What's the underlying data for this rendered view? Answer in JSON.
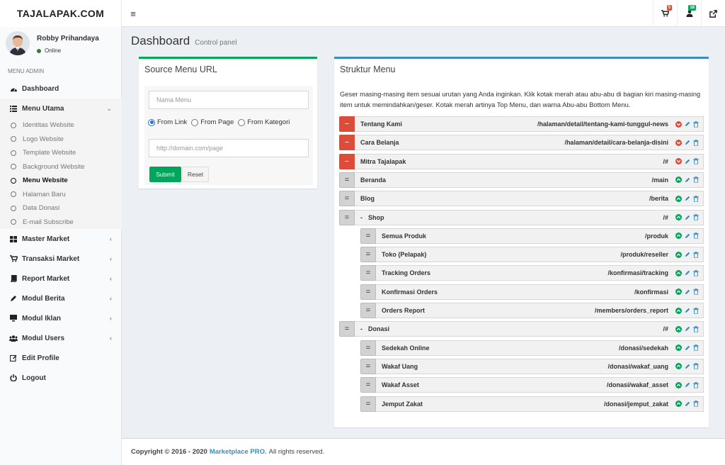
{
  "header": {
    "brand": "TAJALAPAK.COM",
    "cart_badge": "5",
    "users_badge": "18"
  },
  "colors": {
    "accent": "#3c8dbc",
    "success": "#00a65a",
    "danger": "#dd4b39"
  },
  "user": {
    "name": "Robby Prihandaya",
    "status": "Online"
  },
  "sidebar": {
    "header": "MENU ADMIN",
    "items": [
      {
        "label": "Dashboard",
        "icon": "dashboard-icon"
      },
      {
        "label": "Menu Utama",
        "icon": "list-icon"
      },
      {
        "label": "Master Market",
        "icon": "grid-icon"
      },
      {
        "label": "Transaksi Market",
        "icon": "cart-icon"
      },
      {
        "label": "Report Market",
        "icon": "book-icon"
      },
      {
        "label": "Modul Berita",
        "icon": "pencil-icon"
      },
      {
        "label": "Modul Iklan",
        "icon": "tv-icon"
      },
      {
        "label": "Modul Users",
        "icon": "users-icon"
      },
      {
        "label": "Edit Profile",
        "icon": "edit-icon"
      },
      {
        "label": "Logout",
        "icon": "power-icon"
      }
    ],
    "submenu": [
      "Identitas Website",
      "Logo Website",
      "Template Website",
      "Background Website",
      "Menu Website",
      "Halaman Baru",
      "Data Donasi",
      "E-mail Subscribe"
    ]
  },
  "page": {
    "title": "Dashboard",
    "subtitle": "Control panel"
  },
  "source_box": {
    "title": "Source Menu URL",
    "name_placeholder": "Nama Menu",
    "radio_options": [
      "From Link",
      "From Page",
      "From Kategori"
    ],
    "selected": "From Link",
    "url_placeholder": "http://domain.com/page",
    "submit": "Submit",
    "reset": "Reset"
  },
  "struktur": {
    "title": "Struktur Menu",
    "instructions": "Geser masing-masing item sesuai urutan yang Anda inginkan. Klik kotak merah atau abu-abu di bagian kiri masing-masing item untuk memindahkan/geser. Kotak merah artinya Top Menu, dan warna Abu-abu Bottom Menu.",
    "items": [
      {
        "title": "Tentang Kami",
        "link": "/halaman/detail/tentang-kami-tunggul-news",
        "type": "top",
        "level": 0
      },
      {
        "title": "Cara Belanja",
        "link": "/halaman/detail/cara-belanja-disini",
        "type": "top",
        "level": 0
      },
      {
        "title": "Mitra Tajalapak",
        "link": "/#",
        "type": "top",
        "level": 0
      },
      {
        "title": "Beranda",
        "link": "/main",
        "type": "bottom",
        "level": 0
      },
      {
        "title": "Blog",
        "link": "/berita",
        "type": "bottom",
        "level": 0
      },
      {
        "title": "Shop",
        "link": "/#",
        "type": "bottom",
        "level": 0,
        "collapsible": true
      },
      {
        "title": "Semua Produk",
        "link": "/produk",
        "type": "bottom",
        "level": 1
      },
      {
        "title": "Toko (Pelapak)",
        "link": "/produk/reseller",
        "type": "bottom",
        "level": 1
      },
      {
        "title": "Tracking Orders",
        "link": "/konfirmasi/tracking",
        "type": "bottom",
        "level": 1
      },
      {
        "title": "Konfirmasi Orders",
        "link": "/konfirmasi",
        "type": "bottom",
        "level": 1
      },
      {
        "title": "Orders Report",
        "link": "/members/orders_report",
        "type": "bottom",
        "level": 1
      },
      {
        "title": "Donasi",
        "link": "/#",
        "type": "bottom",
        "level": 0,
        "collapsible": true
      },
      {
        "title": "Sedekah Online",
        "link": "/donasi/sedekah",
        "type": "bottom",
        "level": 1
      },
      {
        "title": "Wakaf Uang",
        "link": "/donasi/wakaf_uang",
        "type": "bottom",
        "level": 1
      },
      {
        "title": "Wakaf Asset",
        "link": "/donasi/wakaf_asset",
        "type": "bottom",
        "level": 1
      },
      {
        "title": "Jemput Zakat",
        "link": "/donasi/jemput_zakat",
        "type": "bottom",
        "level": 1
      }
    ]
  },
  "footer": {
    "copyright": "Copyright © 2016 - 2020",
    "brand": "Marketplace PRO.",
    "rights": "All rights reserved."
  }
}
